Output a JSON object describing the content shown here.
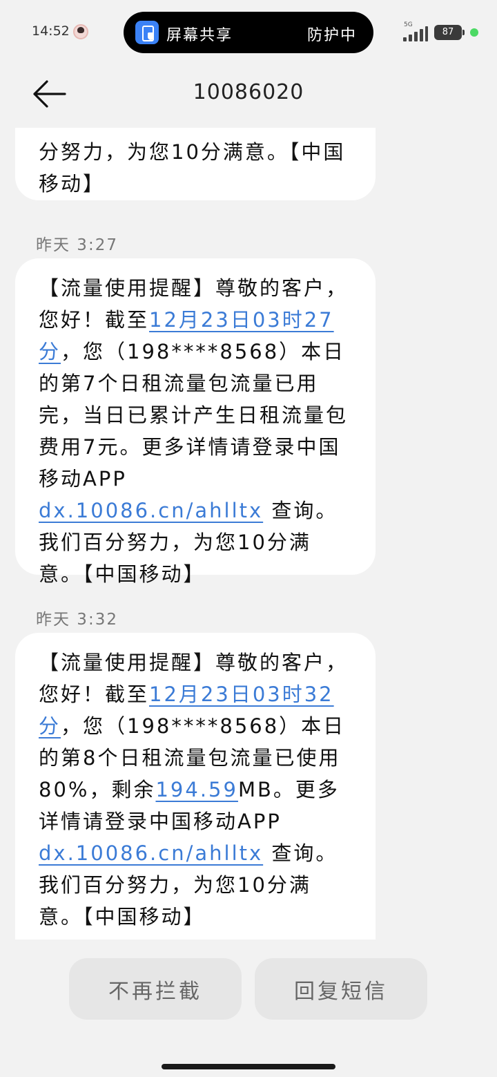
{
  "status_bar": {
    "time": "14:52",
    "screen_share_label": "屏幕共享",
    "protection_label": "防护中",
    "network": "5G",
    "battery": "87",
    "charge_color": "#4cd964"
  },
  "header": {
    "title": "10086020",
    "back_icon": "arrow-left-icon"
  },
  "messages": [
    {
      "segments": [
        "分努力，为您10分满意。【中国移动】"
      ]
    },
    {
      "time": "昨天  3:27",
      "segments": [
        "【流量使用提醒】尊敬的客户，您好！截至",
        "12月23日03时27分",
        "，您（198****8568）本日的第7个日租流量包流量已用完，当日已累计产生日租流量包费用7元。更多详情请登录中国移动APP ",
        "dx.10086.cn/ahlltx",
        " 查询。我们百分努力，为您10分满意。【中国移动】"
      ]
    },
    {
      "time": "昨天  3:32",
      "segments": [
        "【流量使用提醒】尊敬的客户，您好！截至",
        "12月23日03时32分",
        "，您（198****8568）本日的第8个日租流量包流量已使用80%，剩余",
        "194.59",
        "MB。更多详情请登录中国移动APP ",
        "dx.10086.cn/ahlltx",
        " 查询。我们百分努力，为您10分满意。【中国移动】"
      ]
    }
  ],
  "actions": {
    "unblock": "不再拦截",
    "reply": "回复短信"
  },
  "colors": {
    "link": "#3b7bd6",
    "background": "#f2f2f2",
    "bubble": "#ffffff"
  }
}
